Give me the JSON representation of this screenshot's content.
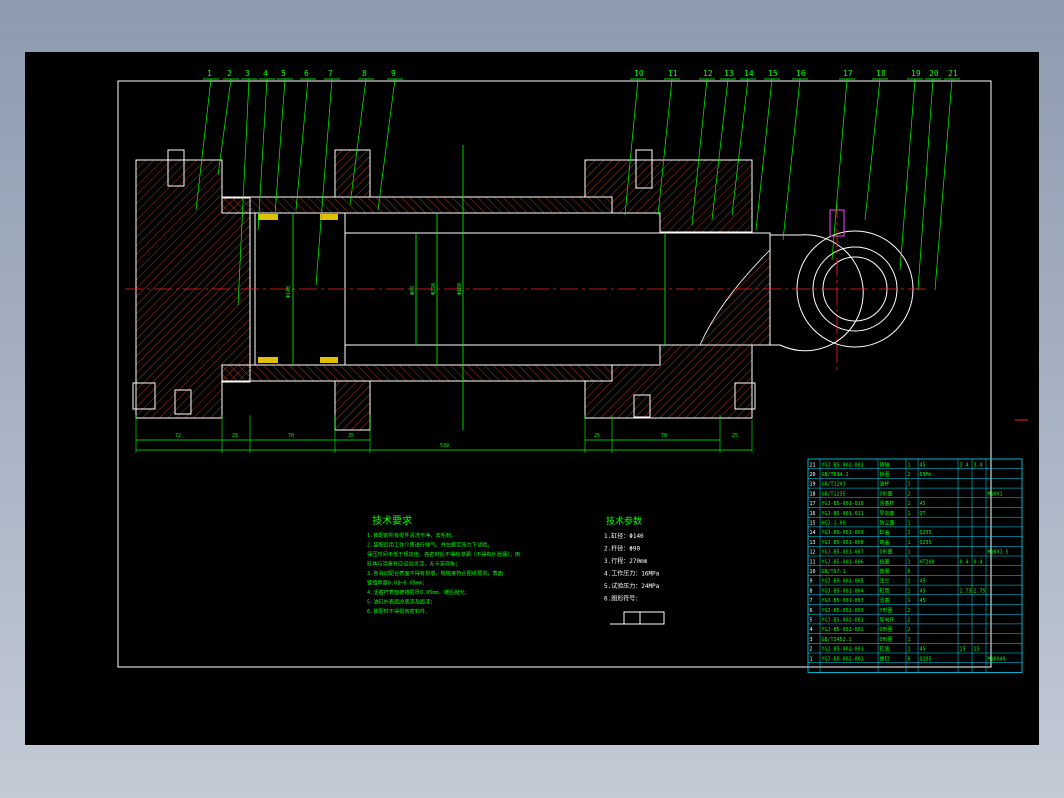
{
  "balloons": [
    "1",
    "2",
    "3",
    "4",
    "5",
    "6",
    "7",
    "8",
    "9",
    "10",
    "11",
    "12",
    "13",
    "14",
    "15",
    "16",
    "17",
    "18",
    "19",
    "20",
    "21"
  ],
  "dimensions": {
    "bottom_segments": [
      "72",
      "25",
      "70",
      "35",
      "25",
      "70",
      "25"
    ],
    "overall": "539",
    "bore": "Φ140",
    "rod": "Φ90",
    "flange": "Φ220",
    "rod_end": "Φ180"
  },
  "tech_requirements": {
    "title": "技术要求",
    "lines": [
      "1.装配前所有零件清洗干净，去毛刺。",
      "2.装配后用工作介质进行排气，并在额定压力下试验，",
      "保压时间不低于规定值，各密封处不得有渗漏（不得有外泄漏）；用",
      "缸体与活塞杆应运动灵活，无卡滞现象；",
      "3.各滑动配合表面不得有划痕，粗糙度符合图纸要求，表面",
      "镀铬厚度0.03~0.05mm；",
      "4.活塞杆表面镀铬层厚0.05mm，镀后抛光；",
      "5.油缸外表面涂底漆及面漆；",
      "6.装配时不得损伤密封件。"
    ]
  },
  "tech_params": {
    "title": "技术参数",
    "lines": [
      "1.缸径：Φ140",
      "2.杆径：Φ90",
      "3.行程：270mm",
      "4.工作压力：16MPa",
      "5.试验压力：24MPa",
      "6.图形符号："
    ]
  },
  "parts_table": {
    "rows": [
      [
        "21",
        "YGJ-B5-002-002",
        "销轴",
        "1",
        "45",
        "3.4",
        "3.4",
        ""
      ],
      [
        "20",
        "GB/T894.1",
        "挡圈",
        "2",
        "65Mn",
        "",
        "",
        ""
      ],
      [
        "19",
        "GB/T1243",
        "油杯",
        "1",
        "",
        "",
        "",
        ""
      ],
      [
        "18",
        "GB/T1235",
        "O形圈",
        "2",
        "",
        "",
        "",
        "M10X1"
      ],
      [
        "17",
        "YGJ-B5-001-010",
        "活塞杆",
        "1",
        "45",
        "",
        "",
        ""
      ],
      [
        "16",
        "YGJ-B5-001-011",
        "导向套",
        "1",
        "QT",
        "",
        "",
        ""
      ],
      [
        "15",
        "HGJ-1-00",
        "防尘圈",
        "1",
        "",
        "",
        "",
        ""
      ],
      [
        "14",
        "YGJ-B5-001-009",
        "缸盖",
        "1",
        "Q235",
        "",
        "",
        ""
      ],
      [
        "13",
        "YGJ-B5-001-008",
        "端盖",
        "1",
        "Q235",
        "",
        "",
        ""
      ],
      [
        "12",
        "YGJ-B5-001-007",
        "O形圈",
        "1",
        "",
        "",
        "",
        "M16X1.5"
      ],
      [
        "11",
        "YGJ-B5-001-006",
        "挡圈",
        "1",
        "HT200",
        "0.4",
        "0.4",
        ""
      ],
      [
        "10",
        "GB/T97.1",
        "垫圈",
        "6",
        "",
        "",
        "",
        ""
      ],
      [
        "9",
        "YGJ-B5-001-005",
        "法兰",
        "1",
        "45",
        "",
        "",
        ""
      ],
      [
        "8",
        "YGJ-B5-001-004",
        "缸筒",
        "1",
        "45",
        "2.75",
        "2.75",
        ""
      ],
      [
        "7",
        "YGJ-B5-001-003",
        "活塞",
        "1",
        "45",
        "",
        "",
        ""
      ],
      [
        "6",
        "YGJ-B5-002-003",
        "Y形圈",
        "2",
        "",
        "",
        "",
        ""
      ],
      [
        "5",
        "YGJ-B5-002-001",
        "导向环",
        "2",
        "",
        "",
        "",
        ""
      ],
      [
        "4",
        "YGJ-B5-002-002",
        "O形圈",
        "2",
        "",
        "",
        "",
        ""
      ],
      [
        "3",
        "GB/T3452.1",
        "O形圈",
        "1",
        "",
        "",
        "",
        ""
      ],
      [
        "2",
        "YGJ-B5-002-001",
        "缸底",
        "1",
        "45",
        "15",
        "15",
        ""
      ],
      [
        "1",
        "YGJ-B5-002-001",
        "螺钉",
        "6",
        "Q235",
        "",
        "",
        "M10X40"
      ]
    ]
  }
}
